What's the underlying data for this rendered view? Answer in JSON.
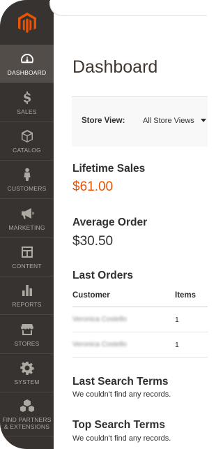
{
  "colors": {
    "sidebar_bg": "#373330",
    "sidebar_active_bg": "#524d49",
    "brand_orange": "#eb5202",
    "lifetime_sales_value": "#eb5202",
    "text_dark": "#303030",
    "title": "#41362f"
  },
  "sidebar": {
    "logo_icon": "magento-logo-icon",
    "items": [
      {
        "label": "DASHBOARD",
        "icon": "speedometer-icon",
        "active": true
      },
      {
        "label": "SALES",
        "icon": "dollar-icon",
        "active": false
      },
      {
        "label": "CATALOG",
        "icon": "cube-icon",
        "active": false
      },
      {
        "label": "CUSTOMERS",
        "icon": "person-icon",
        "active": false
      },
      {
        "label": "MARKETING",
        "icon": "megaphone-icon",
        "active": false
      },
      {
        "label": "CONTENT",
        "icon": "layout-icon",
        "active": false
      },
      {
        "label": "REPORTS",
        "icon": "bar-chart-icon",
        "active": false
      },
      {
        "label": "STORES",
        "icon": "storefront-icon",
        "active": false
      },
      {
        "label": "SYSTEM",
        "icon": "gear-icon",
        "active": false
      },
      {
        "label": "FIND PARTNERS\n& EXTENSIONS",
        "icon": "boxes-icon",
        "active": false
      }
    ]
  },
  "main": {
    "title": "Dashboard",
    "store_view": {
      "label": "Store View:",
      "selected": "All Store Views"
    },
    "lifetime_sales": {
      "label": "Lifetime Sales",
      "value": "$61.00"
    },
    "average_order": {
      "label": "Average Order",
      "value": "$30.50"
    },
    "last_orders": {
      "title": "Last Orders",
      "columns": [
        "Customer",
        "Items"
      ],
      "rows": [
        {
          "customer": "Veronica Costello",
          "items": "1"
        },
        {
          "customer": "Veronica Costello",
          "items": "1"
        }
      ]
    },
    "last_search_terms": {
      "title": "Last Search Terms",
      "empty": "We couldn't find any records."
    },
    "top_search_terms": {
      "title": "Top Search Terms",
      "empty": "We couldn't find any records."
    }
  }
}
